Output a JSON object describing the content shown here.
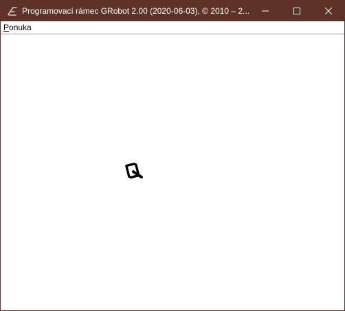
{
  "window": {
    "title": "Programovací rámec GRobot 2.00 (2020-06-03), © 2010 – 2...",
    "icon": "grobot-app-icon",
    "controls": [
      "minimize-icon",
      "maximize-icon",
      "close-icon"
    ]
  },
  "menubar": {
    "items": [
      {
        "label_accel": "P",
        "label_rest": "onuka"
      }
    ]
  },
  "canvas": {
    "robot": {
      "icon": "robot-cursor-icon"
    }
  },
  "colors": {
    "titlebar": "#5e3226",
    "canvas": "#ffffff",
    "robot": "#000000"
  }
}
